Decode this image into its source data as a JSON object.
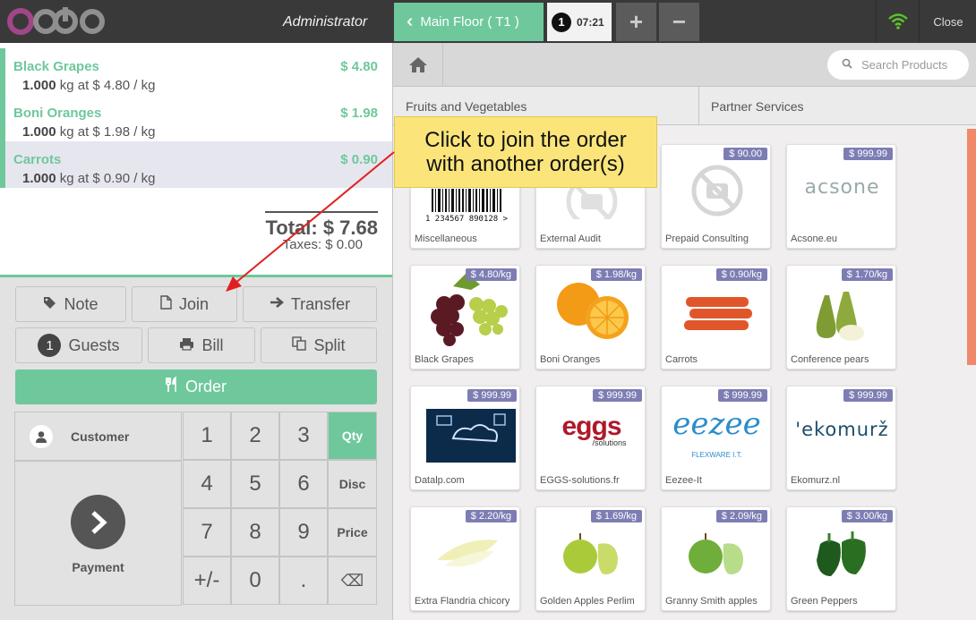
{
  "topbar": {
    "logo": "odoo",
    "user": "Administrator",
    "floor_button": "Main Floor ( T1 )",
    "order_count": "1",
    "order_time": "07:21",
    "add_label": "+",
    "remove_label": "−",
    "close_label": "Close"
  },
  "order": {
    "lines": [
      {
        "name": "Black Grapes",
        "price": "$ 4.80",
        "qty": "1.000",
        "info": " kg at $ 4.80 / kg"
      },
      {
        "name": "Boni Oranges",
        "price": "$ 1.98",
        "qty": "1.000",
        "info": " kg at $ 1.98 / kg"
      },
      {
        "name": "Carrots",
        "price": "$ 0.90",
        "qty": "1.000",
        "info": " kg at $ 0.90 / kg"
      }
    ],
    "total": "Total: $ 7.68",
    "taxes": "Taxes: $ 0.00"
  },
  "controls": {
    "note": "Note",
    "join": "Join",
    "transfer": "Transfer",
    "guests_count": "1",
    "guests": "Guests",
    "bill": "Bill",
    "split": "Split",
    "order": "Order"
  },
  "numpad": {
    "customer": "Customer",
    "payment": "Payment",
    "keys": [
      "1",
      "2",
      "3",
      "4",
      "5",
      "6",
      "7",
      "8",
      "9",
      "+/-",
      "0",
      "."
    ],
    "qty": "Qty",
    "disc": "Disc",
    "price": "Price",
    "backspace": "⌫"
  },
  "products_header": {
    "search_placeholder": "Search Products",
    "categories": [
      "Fruits and Vegetables",
      "Partner Services"
    ]
  },
  "tooltip": {
    "line1": "Click to join the order",
    "line2": "with another order(s)"
  },
  "products": [
    {
      "name": "Miscellaneous",
      "price": ""
    },
    {
      "name": "External Audit",
      "price": ""
    },
    {
      "name": "Prepaid Consulting",
      "price": "$ 90.00"
    },
    {
      "name": "Acsone.eu",
      "price": "$ 999.99"
    },
    {
      "name": "Black Grapes",
      "price": "$ 4.80/kg"
    },
    {
      "name": "Boni Oranges",
      "price": "$ 1.98/kg"
    },
    {
      "name": "Carrots",
      "price": "$ 0.90/kg"
    },
    {
      "name": "Conference pears",
      "price": "$ 1.70/kg"
    },
    {
      "name": "Datalp.com",
      "price": "$ 999.99"
    },
    {
      "name": "EGGS-solutions.fr",
      "price": "$ 999.99"
    },
    {
      "name": "Eezee-It",
      "price": "$ 999.99"
    },
    {
      "name": "Ekomurz.nl",
      "price": "$ 999.99"
    },
    {
      "name": "Extra Flandria chicory",
      "price": "$ 2.20/kg"
    },
    {
      "name": "Golden Apples Perlim",
      "price": "$ 1.69/kg"
    },
    {
      "name": "Granny Smith apples",
      "price": "$ 2.09/kg"
    },
    {
      "name": "Green Peppers",
      "price": "$ 3.00/kg"
    }
  ],
  "product_images": {
    "barcode_digits": "1 234567 890128 >",
    "acsone_logo": "acsone",
    "eggs_logo": "eggs",
    "eggs_sub": "/solutions",
    "eezee_logo": "eezee",
    "eezee_sub": "FLEXWARE I.T.",
    "ekomurz_logo": "'ekomurž"
  },
  "colors": {
    "accent": "#6ec89b",
    "topbar": "#393939",
    "badge": "#7d7db4",
    "tooltip": "#fbe57b",
    "arrow": "#e02020"
  }
}
